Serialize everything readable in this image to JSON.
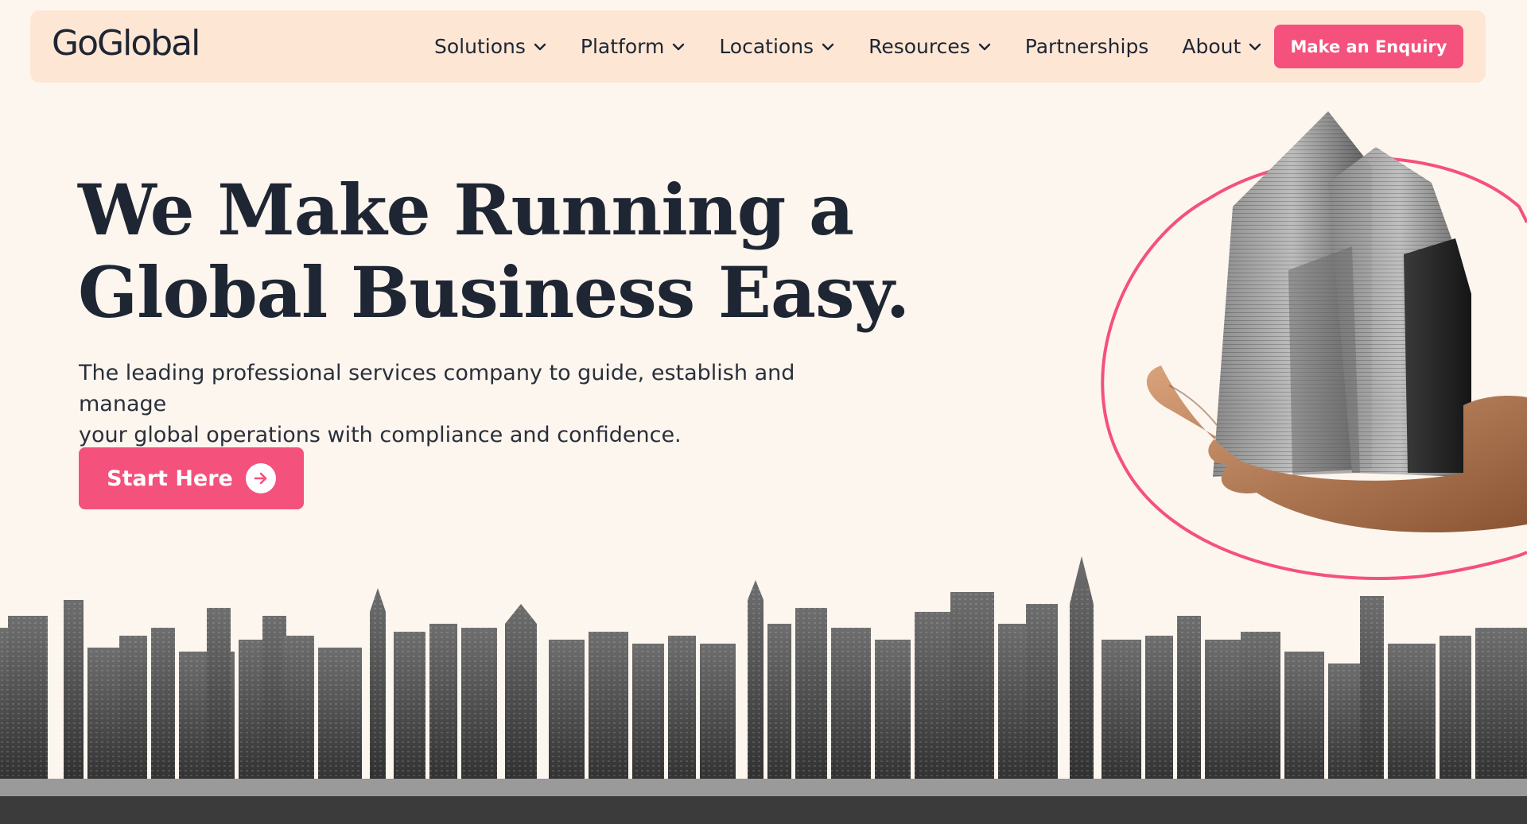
{
  "brand": {
    "logo_text": "GoGlobal"
  },
  "nav": {
    "items": [
      {
        "label": "Solutions",
        "has_dropdown": true
      },
      {
        "label": "Platform",
        "has_dropdown": true
      },
      {
        "label": "Locations",
        "has_dropdown": true
      },
      {
        "label": "Resources",
        "has_dropdown": true
      },
      {
        "label": "Partnerships",
        "has_dropdown": false
      },
      {
        "label": "About",
        "has_dropdown": true
      }
    ],
    "cta_label": "Make an Enquiry"
  },
  "hero": {
    "title_line1": "We Make Running a",
    "title_line2": "Global Business Easy.",
    "subtitle_line1": "The leading professional services company to guide, establish and manage",
    "subtitle_line2": "your global operations with compliance and confidence.",
    "cta_label": "Start Here",
    "cta_icon": "arrow-right-icon"
  },
  "colors": {
    "page_bg": "#fdf6ef",
    "nav_bg": "#fde7d4",
    "accent": "#f4517c",
    "text_dark": "#1f2633"
  },
  "icons": {
    "dropdown": "chevron-down-icon"
  }
}
